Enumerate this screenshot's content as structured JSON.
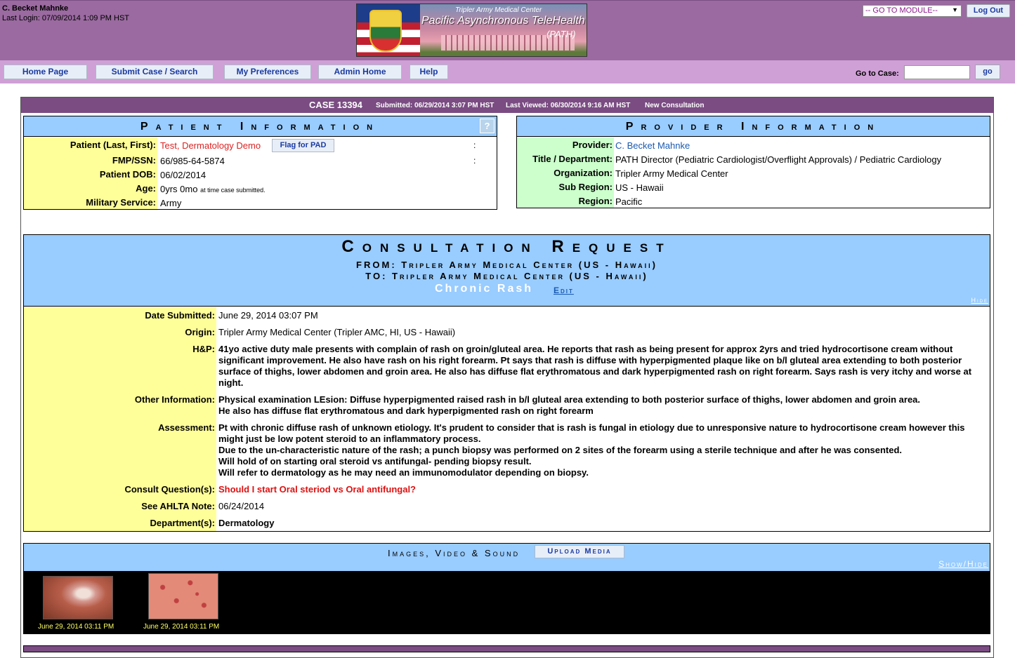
{
  "header": {
    "user_name": "C. Becket Mahnke",
    "last_login": "Last Login: 07/09/2014 1:09 PM HST",
    "banner_line1": "Tripler Army Medical Center",
    "banner_line2": "Pacific Asynchronous TeleHealth",
    "banner_line3": "(PATH)",
    "module_select": "-- GO TO MODULE--",
    "logout": "Log Out"
  },
  "nav": {
    "items": [
      "Home Page",
      "Submit Case / Search",
      "My Preferences",
      "Admin Home",
      "Help"
    ],
    "goto_label": "Go to Case:",
    "goto_value": "",
    "goto_button": "go"
  },
  "case": {
    "number": "CASE 13394",
    "submitted": "Submitted: 06/29/2014 3:07 PM HST",
    "last_viewed": "Last Viewed: 06/30/2014 9:16 AM HST",
    "type": "New Consultation"
  },
  "patient": {
    "title": "Patient Information",
    "help": "?",
    "flag_button": "Flag for PAD",
    "rows": [
      {
        "label": "Patient (Last, First):",
        "value": "Test, Dermatology Demo"
      },
      {
        "label": "FMP/SSN:",
        "value": "66/985-64-5874"
      },
      {
        "label": "Patient DOB:",
        "value": "06/02/2014"
      },
      {
        "label": "Age:",
        "value": "0yrs 0mo",
        "note": "at time case submitted."
      },
      {
        "label": "Military Service:",
        "value": "Army"
      }
    ],
    "colon": ":"
  },
  "provider": {
    "title": "Provider Information",
    "rows": [
      {
        "label": "Provider:",
        "value": "C. Becket Mahnke"
      },
      {
        "label": "Title / Department:",
        "value": "PATH Director (Pediatric Cardiologist/Overflight Approvals) /  Pediatric Cardiology"
      },
      {
        "label": "Organization:",
        "value": "Tripler Army Medical Center"
      },
      {
        "label": "Sub Region:",
        "value": "US - Hawaii"
      },
      {
        "label": "Region:",
        "value": "Pacific"
      }
    ]
  },
  "consult": {
    "title": "Consultation Request",
    "from": "FROM: Tripler Army Medical Center (US - Hawaii)",
    "to": "TO: Tripler Army Medical Center (US - Hawaii)",
    "subject": "Chronic Rash",
    "edit": "Edit",
    "hide": "Hide",
    "rows": [
      {
        "label": "Date Submitted:",
        "value": "June 29, 2014 03:07 PM"
      },
      {
        "label": "Origin:",
        "value": "Tripler Army Medical Center  (Tripler AMC,  HI,  US - Hawaii)"
      },
      {
        "label": "H&P:",
        "value": "41yo active duty male presents with complain of rash on groin/gluteal area. He reports that rash as being present for approx 2yrs and tried hydrocortisone cream without significant improvement. He also have rash on his right forearm. Pt says that rash is diffuse with hyperpigmented plaque like on b/l gluteal area extending to both posterior surface of thighs, lower abdomen and groin area. He also has diffuse flat erythromatous and dark hyperpigmented rash on right forearm.  Says rash is very itchy and worse at night."
      },
      {
        "label": "Other Information:",
        "value_lines": [
          "Physical examination LEsion: Diffuse hyperpigmented raised rash in b/l gluteal area extending to both posterior surface of thighs, lower abdomen and groin area.",
          "He also has diffuse flat erythromatous and dark hyperpigmented rash on right forearm"
        ]
      },
      {
        "label": "Assessment:",
        "value_lines": [
          "Pt with chronic diffuse rash of unknown etiology. It's prudent to consider that is rash is fungal in etiology due to unresponsive nature to hydrocortisone cream however this might just be low potent steroid to an inflammatory process.",
          "Due to the un-characteristic nature of the rash; a punch biopsy was performed on 2 sites of the forearm using a sterile technique and after he was consented.",
          "Will hold of on starting oral steroid vs antifungal- pending biopsy result.",
          "Will refer to dermatology as he may need an immunomodulator depending on biopsy."
        ]
      },
      {
        "label": "Consult Question(s):",
        "value": "Should I start Oral steriod vs Oral antifungal?"
      },
      {
        "label": "See AHLTA Note:",
        "value": "06/24/2014"
      },
      {
        "label": "Department(s):",
        "value": "Dermatology"
      }
    ]
  },
  "media": {
    "title": "Images, Video & Sound",
    "upload": "Upload Media",
    "show_hide": "Show/Hide",
    "items": [
      {
        "caption": "June 29, 2014 03:11 PM"
      },
      {
        "caption": "June 29, 2014 03:11 PM"
      }
    ]
  }
}
